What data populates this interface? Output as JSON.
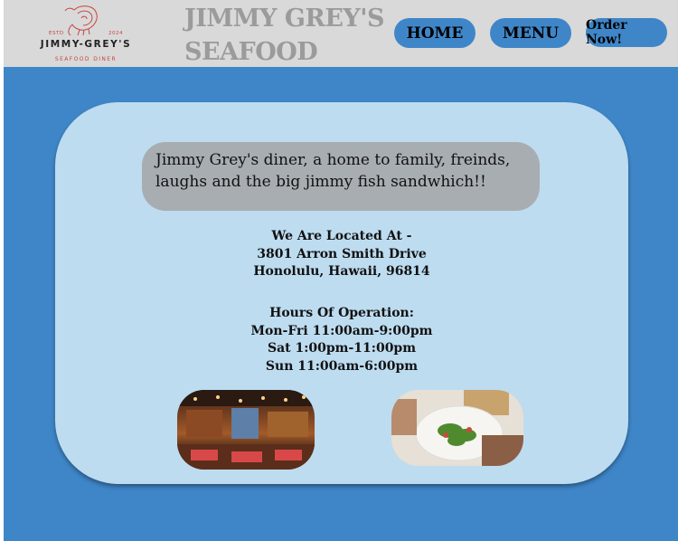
{
  "header": {
    "logo": {
      "estd": "ESTD",
      "year": "2024",
      "name": "JIMMY-GREY'S",
      "subtitle": "SEAFOOD DINER",
      "icon": "shrimp-icon"
    },
    "title_line1": "JIMMY GREY'S",
    "title_line2": "SEAFOOD",
    "nav": {
      "home": "HOME",
      "menu": "MENU",
      "order": "Order Now!"
    }
  },
  "main": {
    "tagline": "Jimmy Grey's diner, a home to family, freinds, laughs and the big jimmy fish sandwhich!!",
    "location": {
      "heading": "We Are Located At -",
      "street": "3801 Arron Smith Drive",
      "city": "Honolulu, Hawaii, 96814"
    },
    "hours": {
      "heading": "Hours Of Operation:",
      "weekdays": "Mon-Fri 11:00am-9:00pm",
      "saturday": "Sat 1:00pm-11:00pm",
      "sunday": "Sun 11:00am-6:00pm"
    }
  },
  "colors": {
    "header_bg": "#d9d9d9",
    "accent_blue": "#3f86c8",
    "card_bg": "#bddcf0",
    "tagline_bg": "#a8adb2",
    "title_gray": "#9b9b9b",
    "logo_red": "#c8453f"
  }
}
